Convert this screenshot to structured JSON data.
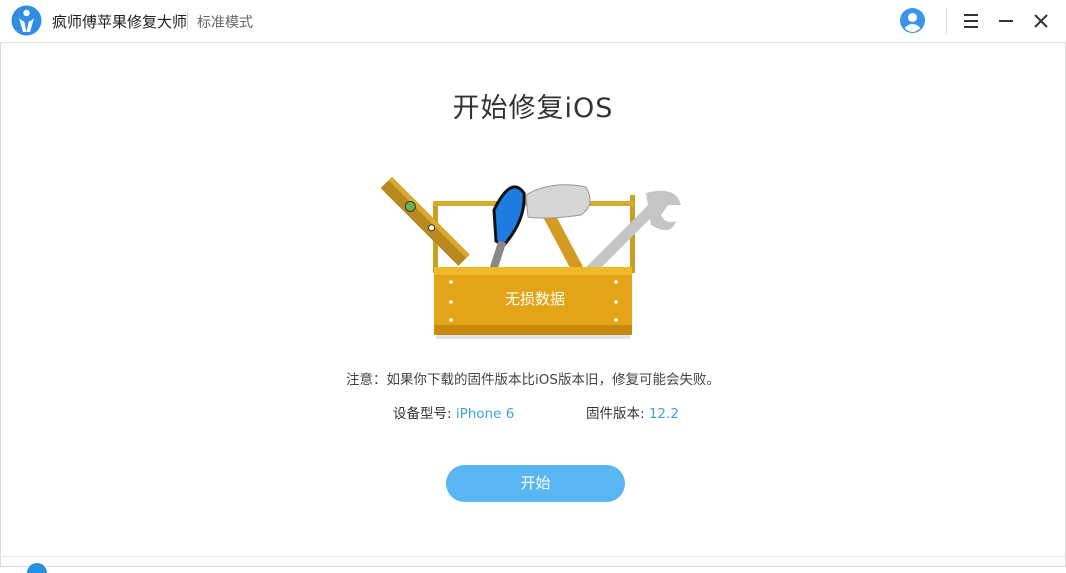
{
  "app": {
    "name": "疯师傅苹果修复大师",
    "mode": "标准模式",
    "logo_icon": "app-logo-icon",
    "accent_color": "#3fa3e0"
  },
  "window_controls": {
    "account_icon": "user-avatar-icon",
    "menu_icon": "hamburger-menu-icon",
    "minimize_icon": "minimize-icon",
    "close_icon": "close-icon"
  },
  "main": {
    "title": "开始修复iOS",
    "illustration_icon": "toolbox-icon",
    "badge_label": "无损数据",
    "note": "注意：如果你下载的固件版本比iOS版本旧，修复可能会失败。",
    "device_model_label": "设备型号: ",
    "device_model_value": "iPhone 6",
    "firmware_label": "固件版本: ",
    "firmware_value": "12.2",
    "start_button_label": "开始",
    "button_color": "#5ab5f3"
  }
}
